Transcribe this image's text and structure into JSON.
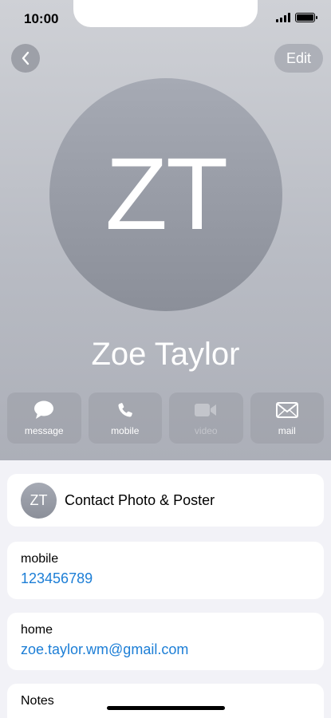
{
  "status_bar": {
    "time": "10:00"
  },
  "nav": {
    "back_icon": "chevron-left-icon",
    "edit_label": "Edit"
  },
  "contact": {
    "initials": "ZT",
    "name": "Zoe Taylor"
  },
  "actions": [
    {
      "label": "message",
      "icon": "message-icon",
      "enabled": true
    },
    {
      "label": "mobile",
      "icon": "phone-icon",
      "enabled": true
    },
    {
      "label": "video",
      "icon": "video-icon",
      "enabled": false
    },
    {
      "label": "mail",
      "icon": "mail-icon",
      "enabled": true
    }
  ],
  "poster": {
    "initials": "ZT",
    "label": "Contact Photo & Poster"
  },
  "fields": {
    "mobile": {
      "label": "mobile",
      "value": "123456789"
    },
    "home": {
      "label": "home",
      "value": "zoe.taylor.wm@gmail.com"
    }
  },
  "notes": {
    "label": "Notes"
  },
  "colors": {
    "link": "#1c7ed6",
    "header_top": "#cfd1d6",
    "header_bottom": "#acafb8"
  }
}
